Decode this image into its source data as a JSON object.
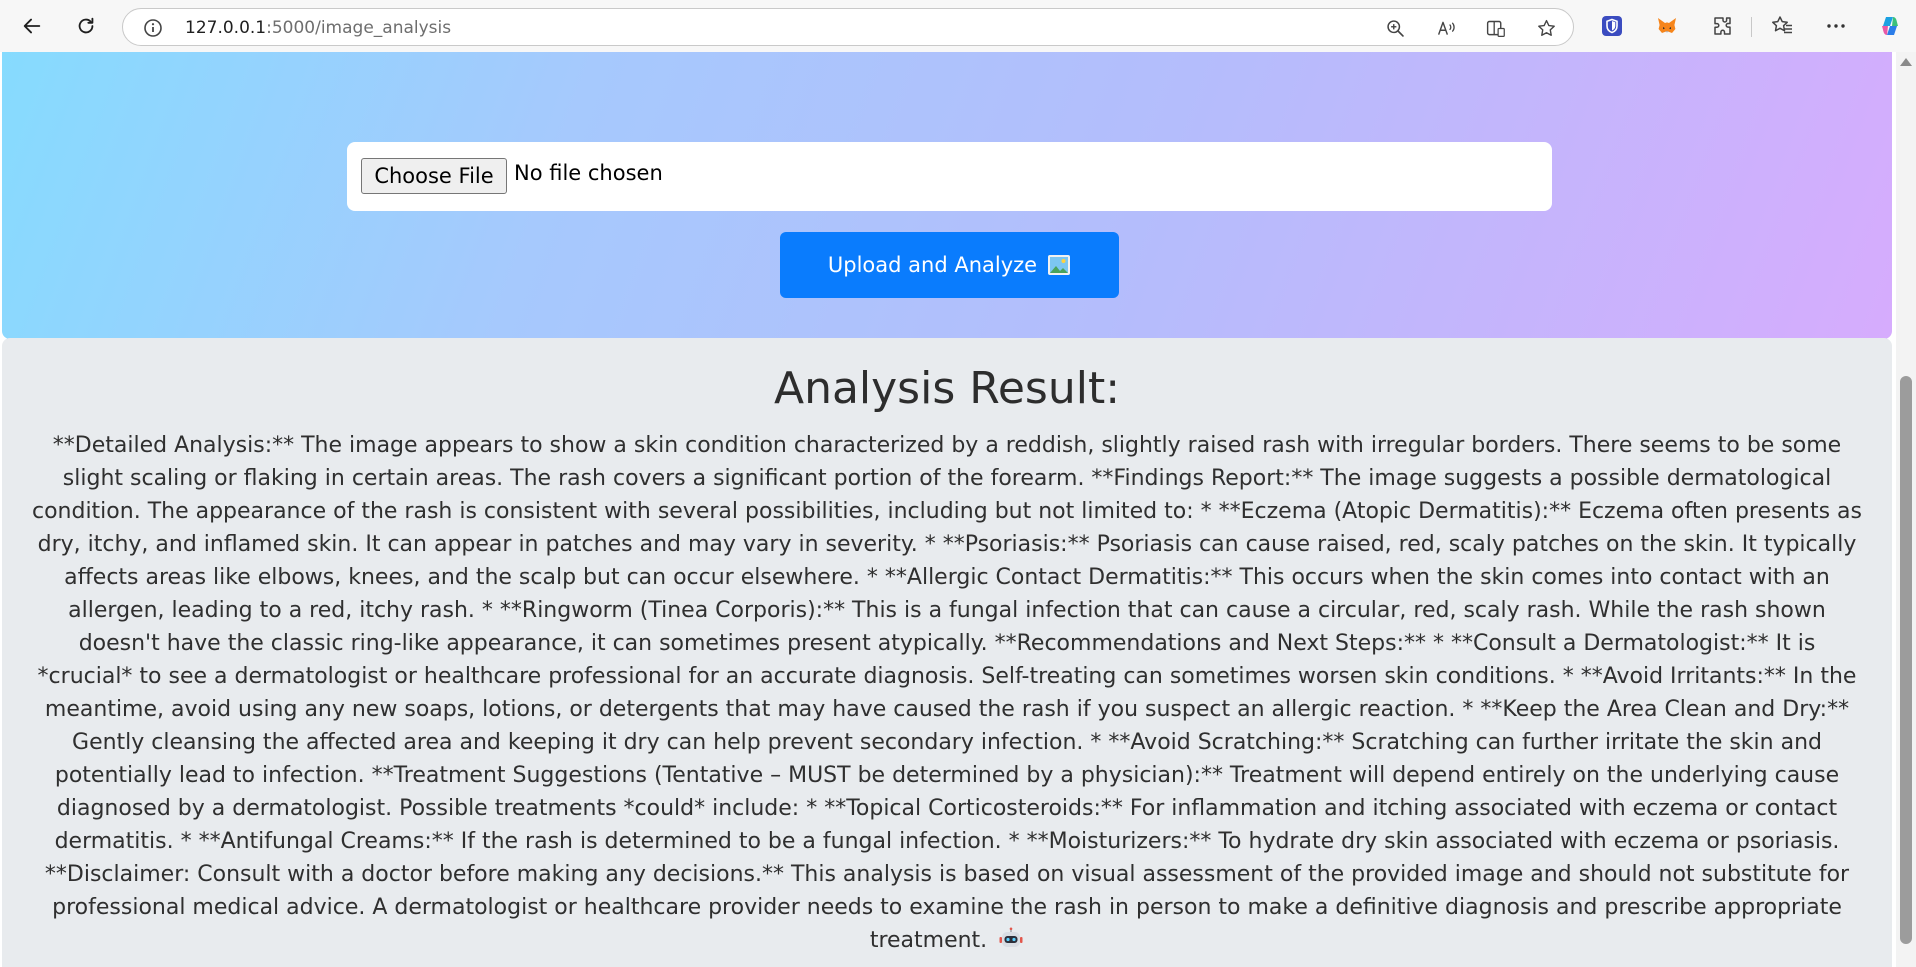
{
  "browser": {
    "url_host": "127.0.0.1",
    "url_path": ":5000/image_analysis",
    "icons": [
      "back-icon",
      "refresh-icon",
      "site-info-icon",
      "zoom-icon",
      "read-aloud-icon",
      "immersive-reader-icon",
      "favorite-star-icon",
      "bitwarden-extension-icon",
      "metamask-extension-icon",
      "extensions-icon",
      "favorites-icon",
      "more-menu-icon",
      "copilot-icon"
    ]
  },
  "upload": {
    "choose_file_label": "Choose File",
    "no_file_text": "No file chosen",
    "upload_button_label": "Upload and Analyze"
  },
  "result": {
    "title": "Analysis Result:",
    "body": "**Detailed Analysis:** The image appears to show a skin condition characterized by a reddish, slightly raised rash with irregular borders. There seems to be some slight scaling or flaking in certain areas. The rash covers a significant portion of the forearm. **Findings Report:** The image suggests a possible dermatological condition. The appearance of the rash is consistent with several possibilities, including but not limited to: * **Eczema (Atopic Dermatitis):** Eczema often presents as dry, itchy, and inflamed skin. It can appear in patches and may vary in severity. * **Psoriasis:** Psoriasis can cause raised, red, scaly patches on the skin. It typically affects areas like elbows, knees, and the scalp but can occur elsewhere. * **Allergic Contact Dermatitis:** This occurs when the skin comes into contact with an allergen, leading to a red, itchy rash. * **Ringworm (Tinea Corporis):** This is a fungal infection that can cause a circular, red, scaly rash. While the rash shown doesn't have the classic ring-like appearance, it can sometimes present atypically. **Recommendations and Next Steps:** * **Consult a Dermatologist:** It is *crucial* to see a dermatologist or healthcare professional for an accurate diagnosis. Self-treating can sometimes worsen skin conditions. * **Avoid Irritants:** In the meantime, avoid using any new soaps, lotions, or detergents that may have caused the rash if you suspect an allergic reaction. * **Keep the Area Clean and Dry:** Gently cleansing the affected area and keeping it dry can help prevent secondary infection. * **Avoid Scratching:** Scratching can further irritate the skin and potentially lead to infection. **Treatment Suggestions (Tentative – MUST be determined by a physician):** Treatment will depend entirely on the underlying cause diagnosed by a dermatologist. Possible treatments *could* include: * **Topical Corticosteroids:** For inflammation and itching associated with eczema or contact dermatitis. * **Antifungal Creams:** If the rash is determined to be a fungal infection. * **Moisturizers:** To hydrate dry skin associated with eczema or psoriasis. **Disclaimer: Consult with a doctor before making any decisions.** This analysis is based on visual assessment of the provided image and should not substitute for professional medical advice. A dermatologist or healthcare provider needs to examine the rash in person to make a definitive diagnosis and prescribe appropriate treatment."
  },
  "colors": {
    "upload_button": "#0a7cfd",
    "result_background": "#e8ebee",
    "gradient_start": "#86dbfe",
    "gradient_end": "#d6acfd"
  }
}
